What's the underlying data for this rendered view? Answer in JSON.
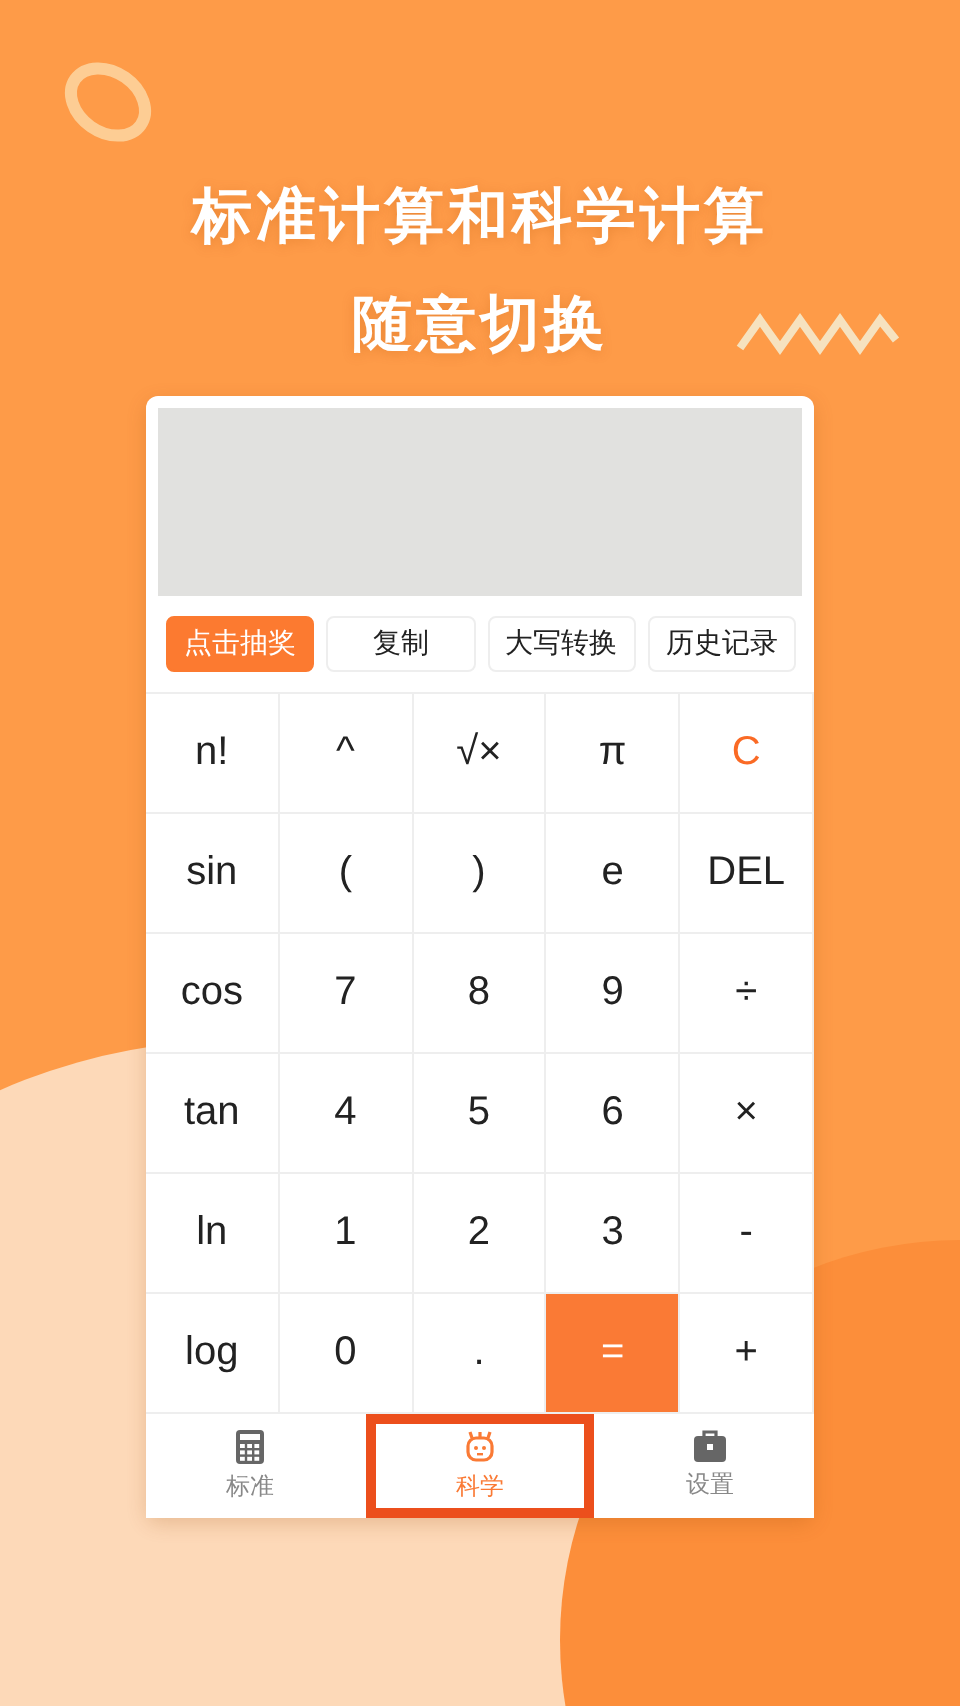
{
  "headline": [
    "标准计算和科学计算",
    "随意切换"
  ],
  "display": {
    "kind": "empty"
  },
  "actions": [
    {
      "label": "点击抽奖",
      "selected": true
    },
    {
      "label": "复制",
      "selected": false
    },
    {
      "label": "大写转换",
      "selected": false
    },
    {
      "label": "历史记录",
      "selected": false
    }
  ],
  "keys": [
    {
      "label": "n!",
      "kind": "normal"
    },
    {
      "label": "^",
      "kind": "normal"
    },
    {
      "label": "√×",
      "kind": "normal"
    },
    {
      "label": "π",
      "kind": "normal"
    },
    {
      "label": "C",
      "kind": "clear"
    },
    {
      "label": "sin",
      "kind": "normal"
    },
    {
      "label": "(",
      "kind": "normal"
    },
    {
      "label": ")",
      "kind": "normal"
    },
    {
      "label": "e",
      "kind": "normal"
    },
    {
      "label": "DEL",
      "kind": "normal"
    },
    {
      "label": "cos",
      "kind": "normal"
    },
    {
      "label": "7",
      "kind": "normal"
    },
    {
      "label": "8",
      "kind": "normal"
    },
    {
      "label": "9",
      "kind": "normal"
    },
    {
      "label": "÷",
      "kind": "normal"
    },
    {
      "label": "tan",
      "kind": "normal"
    },
    {
      "label": "4",
      "kind": "normal"
    },
    {
      "label": "5",
      "kind": "normal"
    },
    {
      "label": "6",
      "kind": "normal"
    },
    {
      "label": "×",
      "kind": "normal"
    },
    {
      "label": "ln",
      "kind": "normal"
    },
    {
      "label": "1",
      "kind": "normal"
    },
    {
      "label": "2",
      "kind": "normal"
    },
    {
      "label": "3",
      "kind": "normal"
    },
    {
      "label": "-",
      "kind": "normal"
    },
    {
      "label": "log",
      "kind": "normal"
    },
    {
      "label": "0",
      "kind": "normal"
    },
    {
      "label": ".",
      "kind": "normal"
    },
    {
      "label": "=",
      "kind": "equals"
    },
    {
      "label": "+",
      "kind": "normal"
    }
  ],
  "tabs": [
    {
      "label": "标准",
      "selected": false
    },
    {
      "label": "科学",
      "selected": true
    },
    {
      "label": "设置",
      "selected": false
    }
  ]
}
